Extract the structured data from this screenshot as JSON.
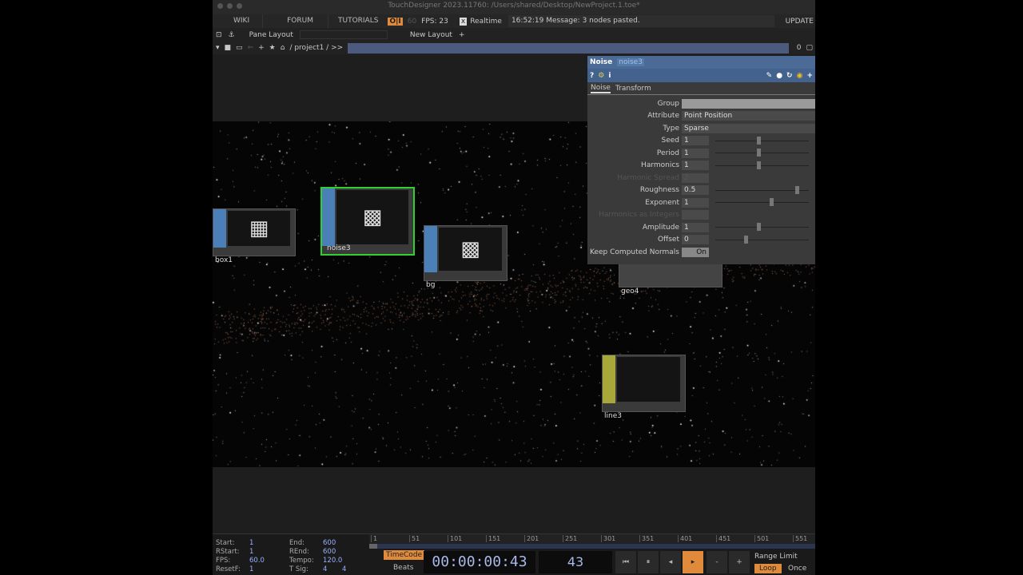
{
  "window": {
    "title": "TouchDesigner 2023.11760: /Users/shared/Desktop/NewProject.1.toe*"
  },
  "menubar": {
    "items": [
      "WIKI",
      "FORUM",
      "TUTORIALS"
    ],
    "perf": "O|I",
    "fps_cap": "60",
    "fps": "FPS:  23",
    "realtime": "Realtime",
    "realtime_check": "x",
    "message": "16:52:19 Message: 3 nodes pasted.",
    "update": "UPDATE"
  },
  "panebar": {
    "pane_layout": "Pane Layout",
    "new_layout": "New Layout",
    "add": "+"
  },
  "pathbar": {
    "path": "/ project1 / >>",
    "count": "0"
  },
  "nodes": [
    {
      "name": "box1"
    },
    {
      "name": "noise3"
    },
    {
      "name": "bg"
    },
    {
      "name": "geo4"
    },
    {
      "name": "line3"
    }
  ],
  "params": {
    "op_type": "Noise",
    "op_name": "noise3",
    "tabs": [
      "Noise",
      "Transform"
    ],
    "rows": [
      {
        "label": "Group",
        "value": ""
      },
      {
        "label": "Attribute",
        "value": "Point Position"
      },
      {
        "label": "Type",
        "value": "Sparse"
      },
      {
        "label": "Seed",
        "value": "1"
      },
      {
        "label": "Period",
        "value": "1"
      },
      {
        "label": "Harmonics",
        "value": "1"
      },
      {
        "label": "Harmonic Spread",
        "value": "2"
      },
      {
        "label": "Roughness",
        "value": "0.5"
      },
      {
        "label": "Exponent",
        "value": "1"
      },
      {
        "label": "Harmonics as Integers",
        "value": ""
      },
      {
        "label": "Amplitude",
        "value": "1"
      },
      {
        "label": "Offset",
        "value": "0"
      },
      {
        "label": "Keep Computed Normals",
        "value": "On"
      }
    ]
  },
  "timeline": {
    "start_l": "Start:",
    "start": "1",
    "rstart_l": "RStart:",
    "rstart": "1",
    "fps_l": "FPS:",
    "fps": "60.0",
    "resetf_l": "ResetF:",
    "resetf": "1",
    "end_l": "End:",
    "end": "600",
    "rend_l": "REnd:",
    "rend": "600",
    "tempo_l": "Tempo:",
    "tempo": "120.0",
    "tsig_l": "T Sig:",
    "tsig_a": "4",
    "tsig_b": "4",
    "ruler": [
      "1",
      "51",
      "101",
      "151",
      "201",
      "251",
      "301",
      "351",
      "401",
      "451",
      "501",
      "551"
    ],
    "timecode_btn": "TimeCode",
    "beats_btn": "Beats",
    "timecode": "00:00:00:43",
    "frame": "43",
    "range_limit": "Range Limit",
    "loop": "Loop",
    "once": "Once"
  },
  "accent": "#e08a3c"
}
